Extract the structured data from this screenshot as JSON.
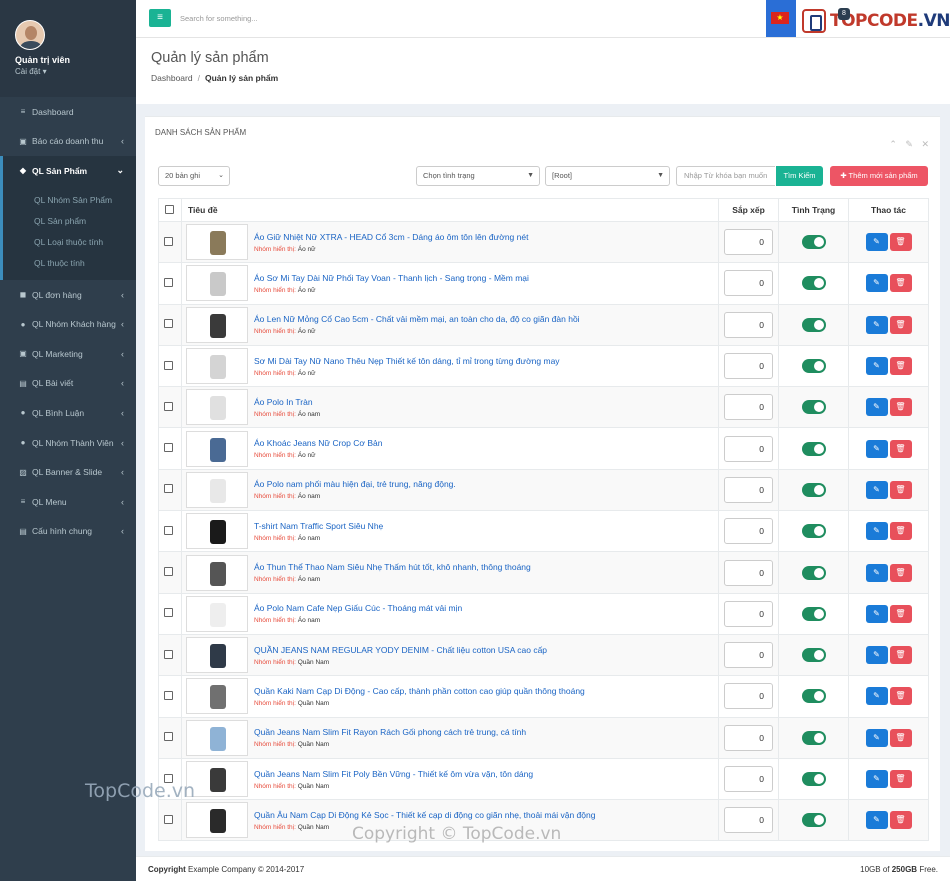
{
  "sidebar": {
    "user_name": "Quản trị viên",
    "user_role": "Cài đặt ▾",
    "items": [
      {
        "icon": "≡",
        "label": "Dashboard",
        "arrow": ""
      },
      {
        "icon": "▣",
        "label": "Báo cáo doanh thu",
        "arrow": "‹"
      },
      {
        "icon": "◆",
        "label": "QL Sản Phẩm",
        "arrow": "⌄"
      }
    ],
    "subitems": [
      "QL Nhóm Sản Phẩm",
      "QL Sản phẩm",
      "QL Loại thuộc tính",
      "QL thuộc tính"
    ],
    "items2": [
      {
        "icon": "◼",
        "label": "QL đơn hàng",
        "arrow": "‹"
      },
      {
        "icon": "●",
        "label": "QL Nhóm Khách hàng",
        "arrow": "‹"
      },
      {
        "icon": "▣",
        "label": "QL Marketing",
        "arrow": "‹"
      },
      {
        "icon": "▤",
        "label": "QL Bài viết",
        "arrow": "‹"
      },
      {
        "icon": "●",
        "label": "QL Bình Luận",
        "arrow": "‹"
      },
      {
        "icon": "●",
        "label": "QL Nhóm Thành Viên",
        "arrow": "‹"
      },
      {
        "icon": "▨",
        "label": "QL Banner & Slide",
        "arrow": "‹"
      },
      {
        "icon": "≡",
        "label": "QL Menu",
        "arrow": "‹"
      },
      {
        "icon": "▤",
        "label": "Cấu hình chung",
        "arrow": "‹"
      }
    ]
  },
  "topbar": {
    "menu_icon": "≡",
    "search_placeholder": "Search for something...",
    "flag": "★",
    "logo_badge": "8",
    "logo_text_a": "TOPCODE",
    "logo_text_b": ".VN"
  },
  "header": {
    "title": "Quản lý sản phẩm",
    "crumb_home": "Dashboard",
    "crumb_sep": "/",
    "crumb_current": "Quản lý sản phẩm"
  },
  "panel": {
    "title": "DANH SÁCH SẢN PHẨM",
    "tools": "⌃ ✎ ✕",
    "page_size": "20 bản ghi",
    "status_select": "Chọn tình trạng",
    "category_select": "[Root]",
    "keyword_placeholder": "Nhập Từ khóa bạn muốn",
    "search_button": "Tìm Kiếm",
    "add_button": "✚ Thêm mới sản phẩm",
    "columns": {
      "title": "Tiêu đề",
      "order": "Sắp xếp",
      "status": "Tình Trạng",
      "actions": "Thao tác"
    },
    "group_label": "Nhóm hiển thị:",
    "edit_icon": "✎",
    "delete_icon": "🗑",
    "rows": [
      {
        "name": "Áo Giữ Nhiệt Nữ XTRA - HEAD Cổ 3cm - Dáng áo ôm tôn lên đường nét",
        "group": "Áo nữ",
        "order": "0",
        "color": "#8a7a5a"
      },
      {
        "name": "Áo Sơ Mi Tay Dài Nữ Phối Tay Voan - Thanh lịch - Sang trọng - Mềm mại",
        "group": "Áo nữ",
        "order": "0",
        "color": "#c9c9c9"
      },
      {
        "name": "Áo Len Nữ Mỏng Cổ Cao 5cm - Chất vải mềm mại, an toàn cho da, độ co giãn đàn hồi",
        "group": "Áo nữ",
        "order": "0",
        "color": "#3a3a3a"
      },
      {
        "name": "Sơ Mi Dài Tay Nữ Nano Thêu Nẹp Thiết kế tôn dáng, tỉ mỉ trong từng đường may",
        "group": "Áo nữ",
        "order": "0",
        "color": "#d4d4d4"
      },
      {
        "name": "Áo Polo In Tràn",
        "group": "Áo nam",
        "order": "0",
        "color": "#e0e0e0"
      },
      {
        "name": "Áo Khoác Jeans Nữ Crop Cơ Bản",
        "group": "Áo nữ",
        "order": "0",
        "color": "#4a6a94"
      },
      {
        "name": "Áo Polo nam phối màu hiện đại, trẻ trung, năng động.",
        "group": "Áo nam",
        "order": "0",
        "color": "#e8e8e8"
      },
      {
        "name": "T-shirt Nam Traffic Sport Siêu Nhẹ",
        "group": "Áo nam",
        "order": "0",
        "color": "#1a1a1a"
      },
      {
        "name": "Áo Thun Thể Thao Nam Siêu Nhẹ Thấm hút tốt, khô nhanh, thông thoáng",
        "group": "Áo nam",
        "order": "0",
        "color": "#555555"
      },
      {
        "name": "Áo Polo Nam Cafe Nẹp Giấu Cúc - Thoáng mát vải mịn",
        "group": "Áo nam",
        "order": "0",
        "color": "#eeeeee"
      },
      {
        "name": "QUẦN JEANS NAM REGULAR YODY DENIM - Chất liệu cotton USA cao cấp",
        "group": "Quần Nam",
        "order": "0",
        "color": "#2f3a48"
      },
      {
        "name": "Quần Kaki Nam Cạp Di Động - Cao cấp, thành phần cotton cao giúp quần thông thoáng",
        "group": "Quần Nam",
        "order": "0",
        "color": "#707070"
      },
      {
        "name": "Quần Jeans Nam Slim Fit Rayon Rách Gối phong cách trẻ trung, cá tính",
        "group": "Quần Nam",
        "order": "0",
        "color": "#8fb3d6"
      },
      {
        "name": "Quần Jeans Nam Slim Fit Poly Bền Vững - Thiết kế ôm vừa vặn, tôn dáng",
        "group": "Quần Nam",
        "order": "0",
        "color": "#3a3a3a"
      },
      {
        "name": "Quần Âu Nam Cạp Di Động Kẻ Sọc - Thiết kế cạp di động co giãn nhẹ, thoải mái vận động",
        "group": "Quần Nam",
        "order": "0",
        "color": "#2a2a2a"
      }
    ]
  },
  "footer": {
    "copyright_bold": "Copyright",
    "copyright_text": " Example Company © 2014-2017",
    "storage_a": "10GB of ",
    "storage_b": "250GB",
    "storage_c": " Free."
  },
  "watermarks": {
    "left": "TopCode.vn",
    "center": "Copyright © TopCode.vn"
  }
}
